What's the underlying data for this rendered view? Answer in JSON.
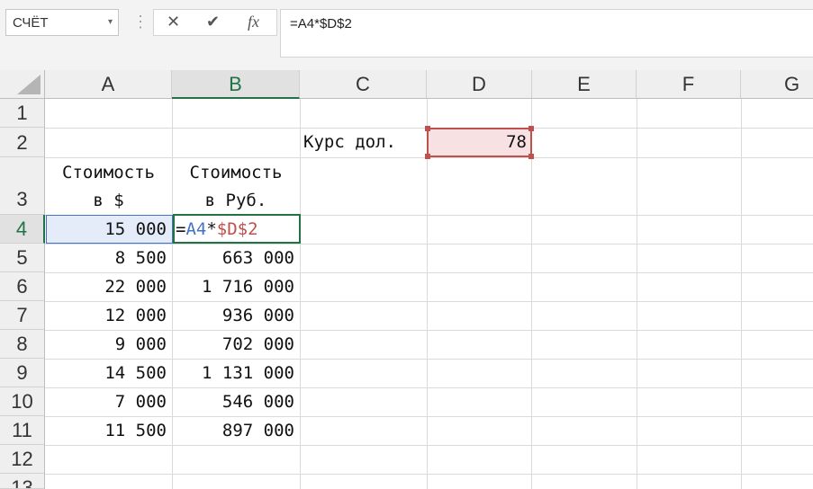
{
  "formula_bar": {
    "name_box": "СЧЁТ",
    "name_box_arrow": "▾",
    "separator": "⋮",
    "cancel_icon": "✕",
    "enter_icon": "✔",
    "fx_label": "fx",
    "formula": "=A4*$D$2"
  },
  "columns": [
    "A",
    "B",
    "C",
    "D",
    "E",
    "F",
    "G"
  ],
  "rows": [
    "1",
    "2",
    "3",
    "4",
    "5",
    "6",
    "7",
    "8",
    "9",
    "10",
    "11",
    "12",
    "13"
  ],
  "cells": {
    "C2": "Курс дол.",
    "D2": "78",
    "A3_line1": "Стоимость",
    "A3_line2": "в $",
    "B3_line1": "Стоимость",
    "B3_line2": "в Руб.",
    "B4_eq": "=",
    "B4_ref1": "A4",
    "B4_op": "*",
    "B4_ref2": "$D$2"
  },
  "col_a": [
    "15 000",
    "8 500",
    "22 000",
    "12 000",
    "9 000",
    "14 500",
    "7 000",
    "11 500"
  ],
  "col_b": [
    "663 000",
    "1 716 000",
    "936 000",
    "702 000",
    "1 131 000",
    "546 000",
    "897 000"
  ],
  "colors": {
    "accent_green": "#217346",
    "ref_blue": "#4472c4",
    "ref_red": "#c0504d"
  }
}
